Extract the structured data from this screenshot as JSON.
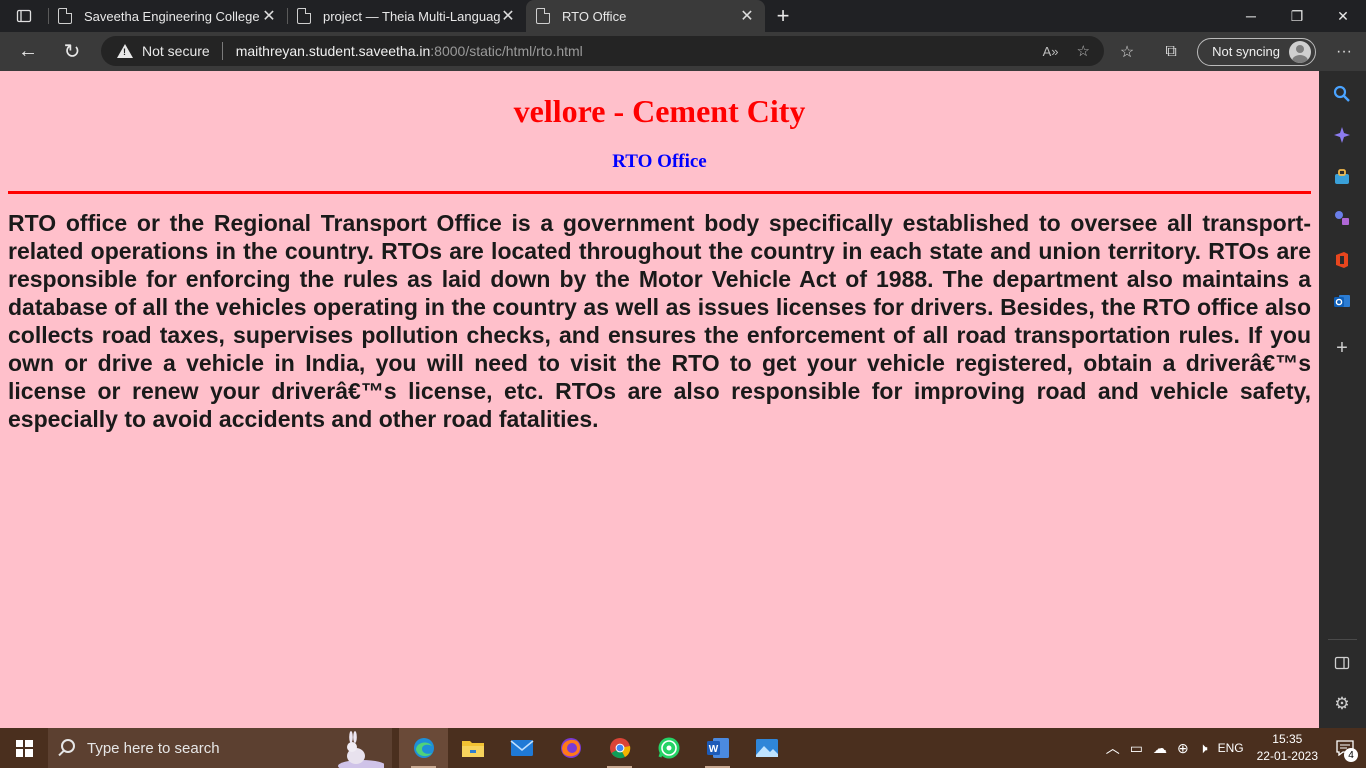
{
  "tabs": [
    {
      "title": "Saveetha Engineering College",
      "close": "✕"
    },
    {
      "title": "project — Theia Multi-Language",
      "close": "✕"
    },
    {
      "title": "RTO Office",
      "close": "✕"
    }
  ],
  "window_controls": {
    "minimize": "─",
    "restore": "❐",
    "close": "✕"
  },
  "addressbar": {
    "security_label": "Not secure",
    "url_host": "maithreyan.student.saveetha.in",
    "url_rest": ":8000/static/html/rto.html"
  },
  "profile": {
    "sync_label": "Not syncing"
  },
  "page": {
    "heading": "vellore - Cement City",
    "subheading": "RTO Office",
    "paragraph": "RTO office or the Regional Transport Office is a government body specifically established to oversee all transport-related operations in the country. RTOs are located throughout the country in each state and union territory. RTOs are responsible for enforcing the rules as laid down by the Motor Vehicle Act of 1988. The department also maintains a database of all the vehicles operating in the country as well as issues licenses for drivers. Besides, the RTO office also collects road taxes, supervises pollution checks, and ensures the enforcement of all road transportation rules. If you own or drive a vehicle in India, you will need to visit the RTO to get your vehicle registered, obtain a driverâ€™s license or renew your driverâ€™s license, etc. RTOs are also responsible for improving road and vehicle safety, especially to avoid accidents and other road fatalities.",
    "colors": {
      "background": "#ffc0cb",
      "heading": "#ff0000",
      "subheading": "#0000ff",
      "rule": "#ff0000"
    }
  },
  "taskbar": {
    "search_placeholder": "Type here to search",
    "language": "ENG",
    "time": "15:35",
    "date": "22-01-2023",
    "notification_count": "4"
  }
}
